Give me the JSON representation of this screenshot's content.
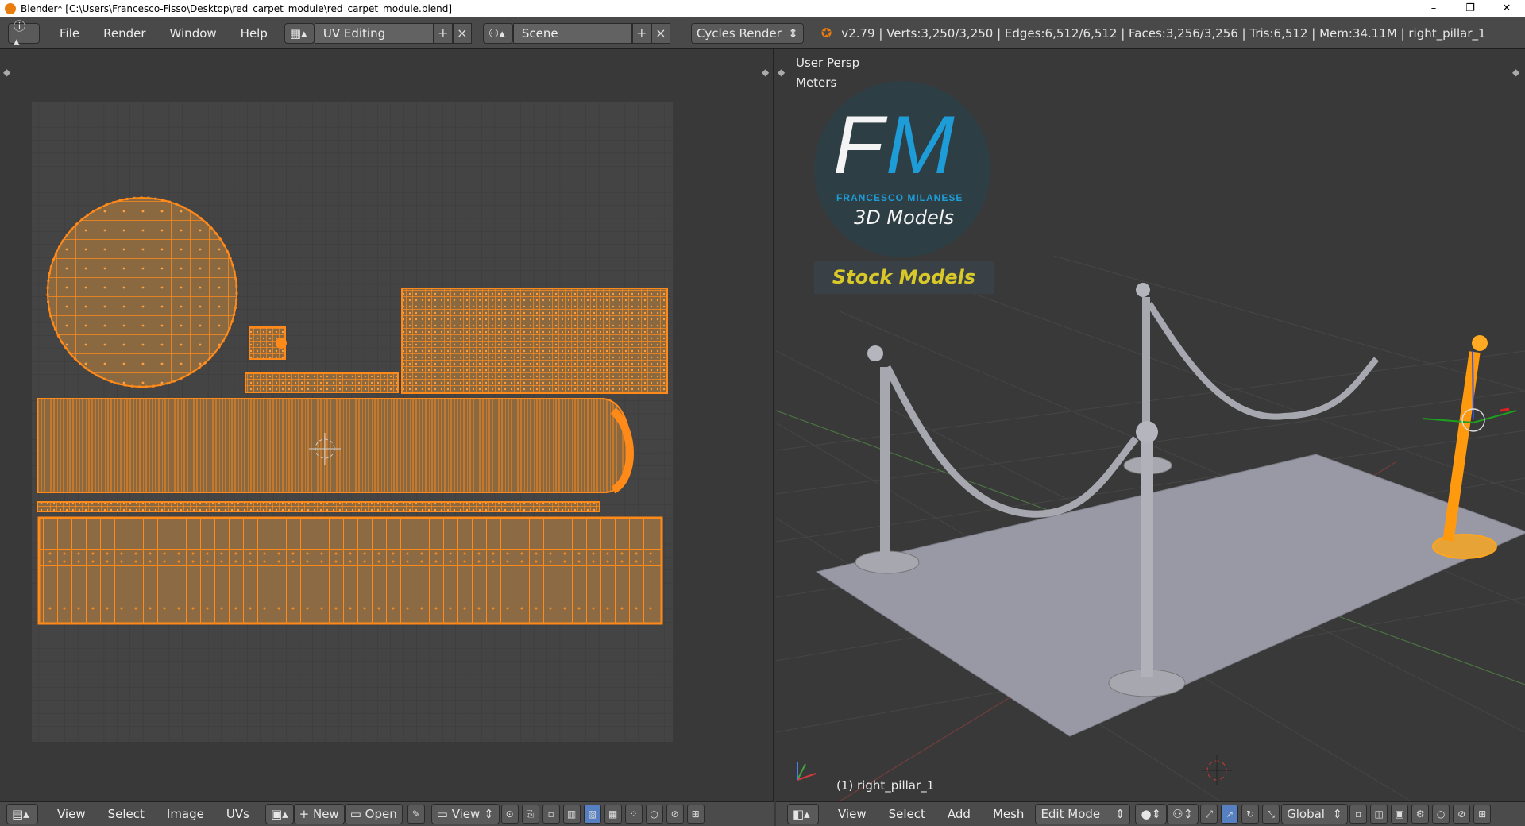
{
  "window": {
    "title": "Blender* [C:\\Users\\Francesco-Fisso\\Desktop\\red_carpet_module\\red_carpet_module.blend]",
    "minimize": "–",
    "restore": "❐",
    "close": "✕"
  },
  "info": {
    "menus": [
      "File",
      "Render",
      "Window",
      "Help"
    ],
    "screen_layout": "UV Editing",
    "scene": "Scene",
    "render_engine": "Cycles Render",
    "stats": "v2.79 | Verts:3,250/3,250 | Edges:6,512/6,512 | Faces:3,256/3,256 | Tris:6,512 | Mem:34.11M | right_pillar_1"
  },
  "uv_editor": {
    "menus": [
      "View",
      "Select",
      "Image",
      "UVs"
    ],
    "new_label": "New",
    "open_label": "Open",
    "view_label": "View"
  },
  "viewport": {
    "view_name": "User Persp",
    "units": "Meters",
    "object_label": "(1) right_pillar_1",
    "menus": [
      "View",
      "Select",
      "Add",
      "Mesh"
    ],
    "mode": "Edit Mode",
    "orientation": "Global"
  },
  "watermark": {
    "monogram_f": "F",
    "monogram_m": "M",
    "brand": "FRANCESCO MILANESE",
    "subtitle": "3D Models",
    "tag": "Stock Models"
  },
  "colors": {
    "accent": "#e87d0d",
    "uv_orange": "#ff8a1a",
    "grid_bg": "#444444"
  }
}
